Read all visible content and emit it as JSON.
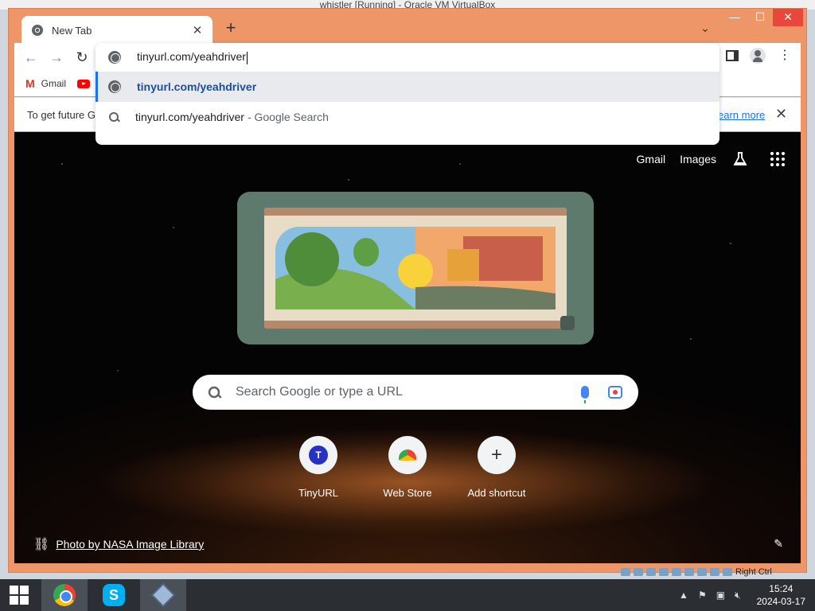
{
  "host": {
    "title": "whistler [Running] - Oracle VM VirtualBox"
  },
  "browser": {
    "tab": {
      "title": "New Tab",
      "close": "✕"
    },
    "new_tab": "+",
    "tab_search": "⌄",
    "window": {
      "minimize": "—",
      "maximize": "☐",
      "close": "✕"
    }
  },
  "toolbar": {
    "back": "←",
    "forward": "→",
    "reload": "↻",
    "menu": "⋮"
  },
  "omnibox": {
    "value": "tinyurl.com/yeahdriver",
    "suggestions": [
      {
        "text": "tinyurl.com/yeahdriver",
        "sub": "",
        "icon": "globe-icon"
      },
      {
        "text": "tinyurl.com/yeahdriver",
        "sub": "- Google Search",
        "icon": "search-icon"
      }
    ]
  },
  "bookmarks": [
    {
      "label": "Gmail",
      "icon": "gmail-icon"
    },
    {
      "label": "",
      "icon": "youtube-icon"
    }
  ],
  "infobar": {
    "text": "To get future G",
    "learn_more": "earn more",
    "close": "✕"
  },
  "ntp": {
    "links": {
      "gmail": "Gmail",
      "images": "Images"
    },
    "search_placeholder": "Search Google or type a URL",
    "shortcuts": [
      {
        "label": "TinyURL",
        "badge": "T"
      },
      {
        "label": "Web Store"
      },
      {
        "label": "Add shortcut",
        "glyph": "+"
      }
    ],
    "photo_credit": "Photo by NASA Image Library",
    "edit": "✎"
  },
  "vbox_status": {
    "text": "Right Ctrl"
  },
  "taskbar": {
    "time": "15:24",
    "date": "2024-03-17"
  }
}
